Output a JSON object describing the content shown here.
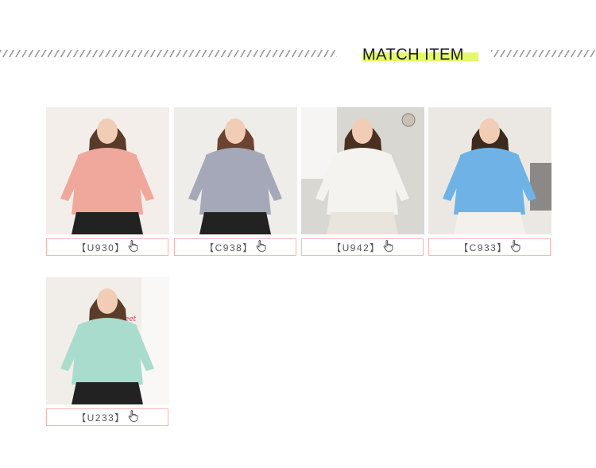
{
  "section": {
    "title": "MATCH ITEM"
  },
  "items": [
    {
      "code": "【U930】",
      "photo_icon": "model-photo-pink-knit",
      "colors": {
        "top": "#f0a79c",
        "bg": "#f3eeea",
        "hair": "#5a3a28",
        "skirt": "#222"
      }
    },
    {
      "code": "【C938】",
      "photo_icon": "model-photo-grey-blazer",
      "colors": {
        "top": "#a4a8b8",
        "bg": "#efede9",
        "hair": "#6a4430",
        "skirt": "#222"
      }
    },
    {
      "code": "【U942】",
      "photo_icon": "model-photo-white-dress-scarf",
      "colors": {
        "top": "#f5f3ef",
        "bg": "#d9d7d2",
        "hair": "#4a3020",
        "skirt": "#e9e4dc"
      }
    },
    {
      "code": "【C933】",
      "photo_icon": "model-photo-blue-cardigan",
      "colors": {
        "top": "#6fb3e6",
        "bg": "#ebe8e3",
        "hair": "#3d2a1e",
        "skirt": "#f4f1ec"
      }
    },
    {
      "code": "【U233】",
      "photo_icon": "model-photo-mint-sweater",
      "colors": {
        "top": "#a9dccd",
        "bg": "#f1eeea",
        "hair": "#5b3b2a",
        "skirt": "#222"
      }
    }
  ]
}
